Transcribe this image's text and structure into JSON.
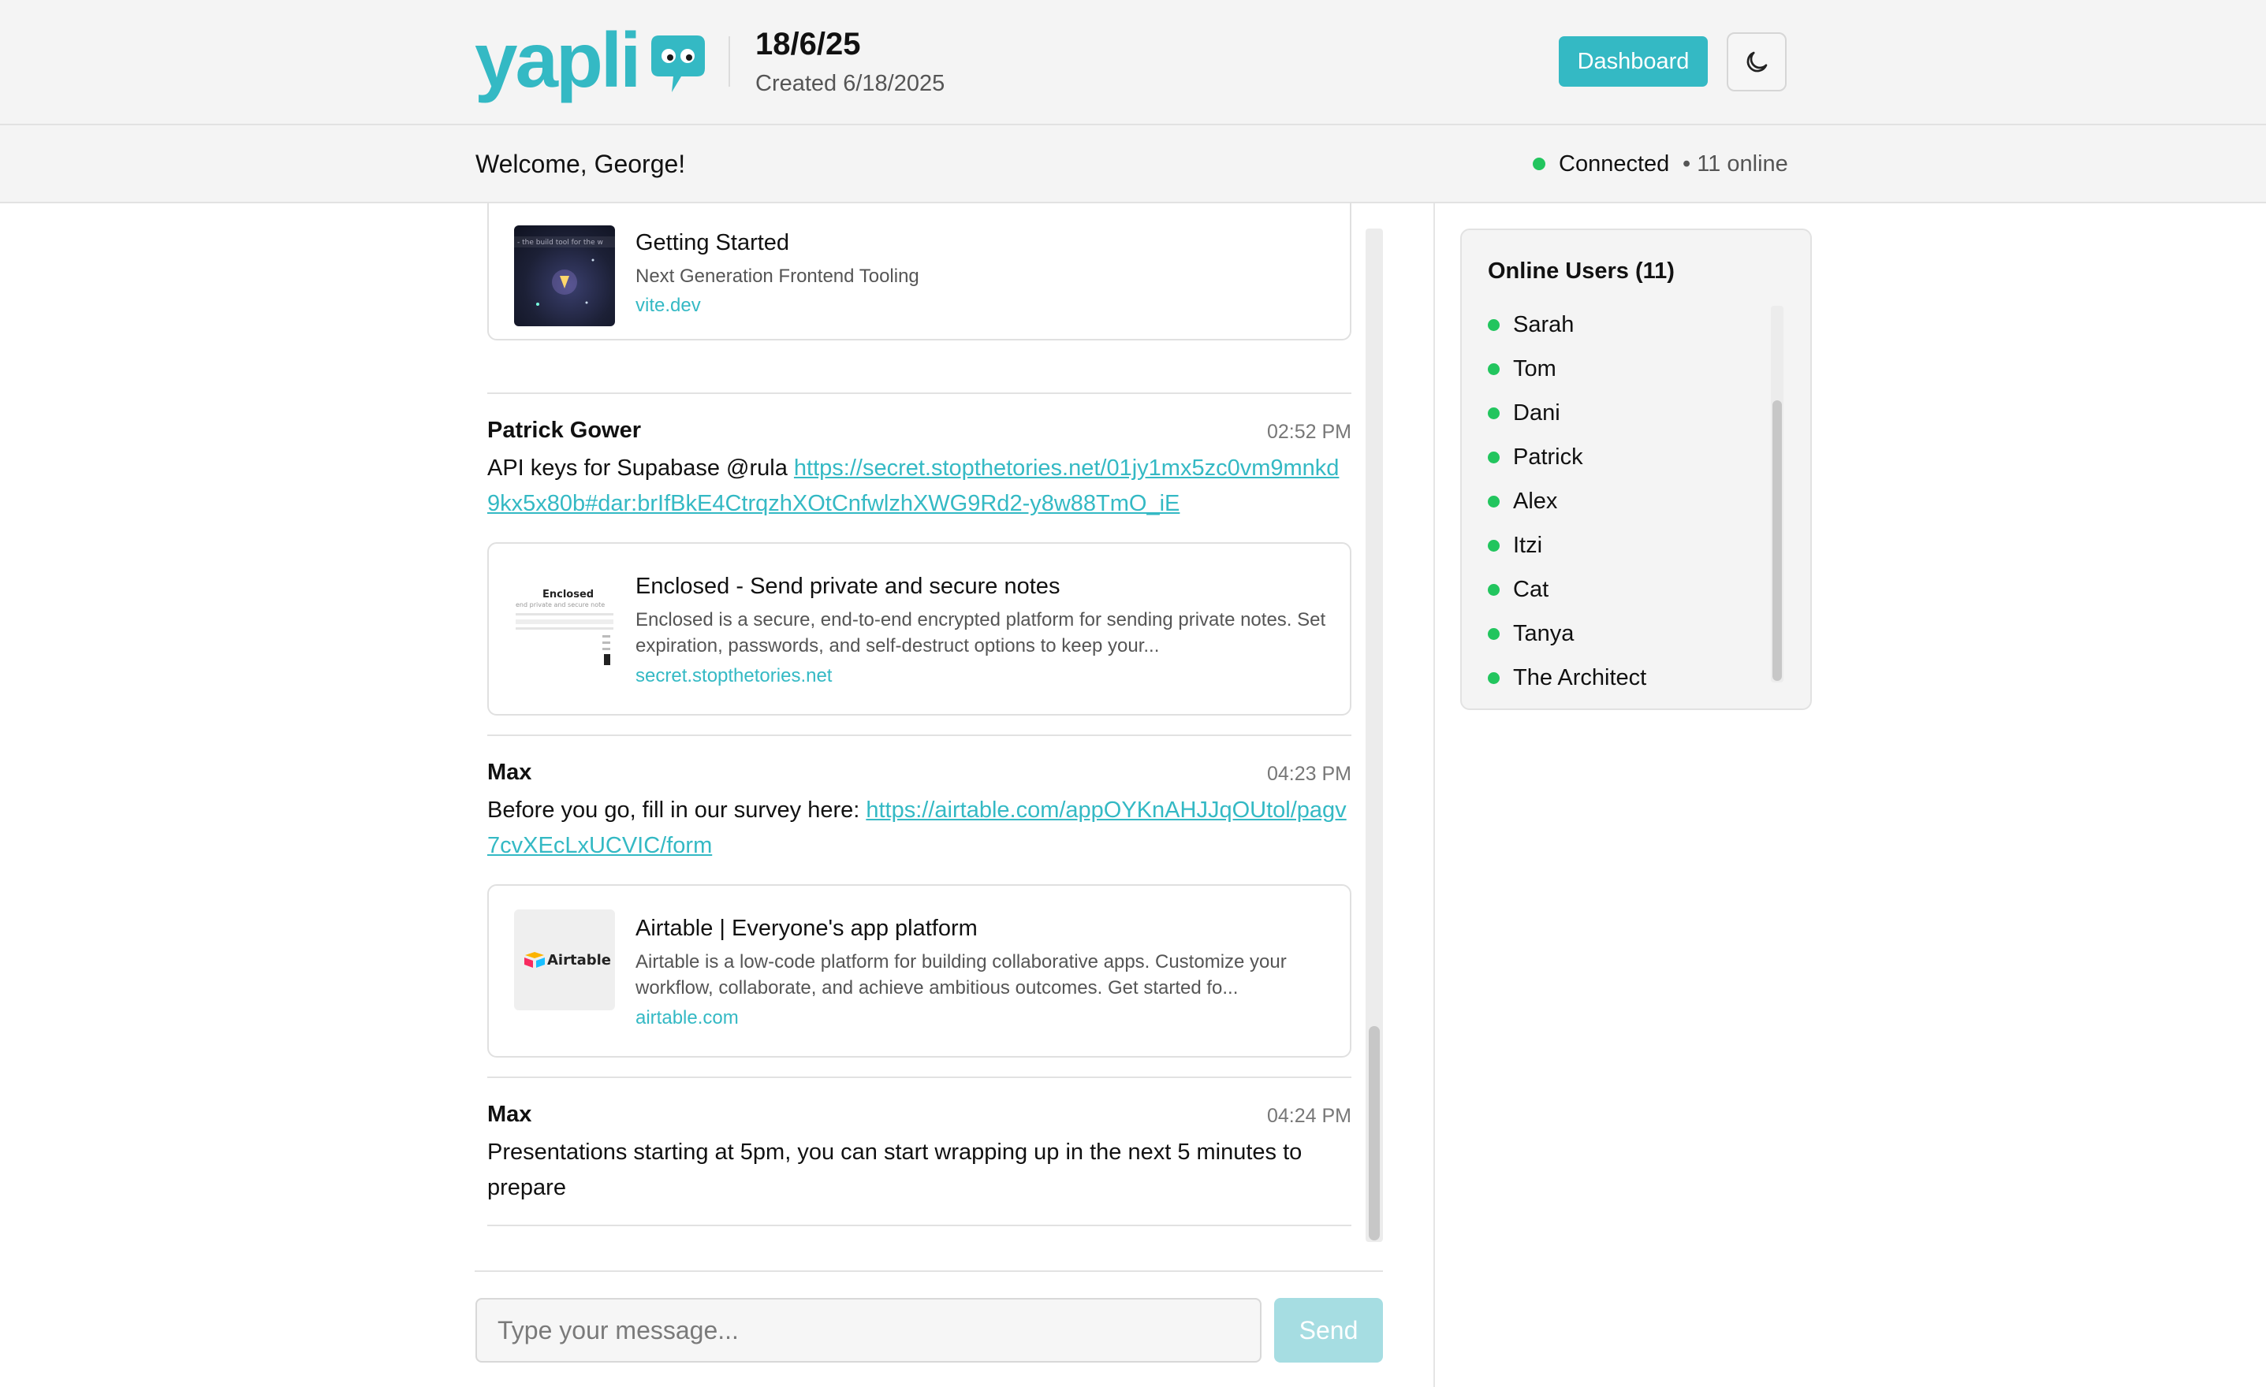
{
  "header": {
    "logo_text": "yapli",
    "room_title": "18/6/25",
    "room_created": "Created 6/18/2025",
    "dashboard_label": "Dashboard",
    "brand_color": "#34b9c4",
    "theme_icon": "moon-icon"
  },
  "subbar": {
    "welcome": "Welcome, George!",
    "status": "Connected",
    "online": "• 11 online",
    "status_color": "#22c55e"
  },
  "messages": [
    {
      "preview": {
        "title": "Getting Started",
        "description": "Next Generation Frontend Tooling",
        "domain": "vite.dev"
      }
    },
    {
      "author": "Patrick Gower",
      "time": "02:52 PM",
      "text": "API keys for Supabase @rula ",
      "link": "https://secret.stopthetories.net/01jy1mx5zc0vm9mnkd9kx5x80b#dar:brIfBkE4CtrqzhXOtCnfwlzhXWG9Rd2-y8w88TmO_iE",
      "preview": {
        "title": "Enclosed - Send private and secure notes",
        "description": "Enclosed is a secure, end-to-end encrypted platform for sending private notes. Set expiration, passwords, and self-destruct options to keep your...",
        "domain": "secret.stopthetories.net",
        "thumb_label": "Enclosed"
      }
    },
    {
      "author": "Max",
      "time": "04:23 PM",
      "text": "Before you go, fill in our survey here: ",
      "link": "https://airtable.com/appOYKnAHJJqOUtol/pagv7cvXEcLxUCVIC/form",
      "preview": {
        "title": "Airtable | Everyone's app platform",
        "description": "Airtable is a low-code platform for building collaborative apps. Customize your workflow, collaborate, and achieve ambitious outcomes. Get started fo...",
        "domain": "airtable.com",
        "thumb_label": "Airtable"
      }
    },
    {
      "author": "Max",
      "time": "04:24 PM",
      "text": "Presentations starting at 5pm, you can start wrapping up in the next 5 minutes to prepare"
    }
  ],
  "composer": {
    "placeholder": "Type your message...",
    "send_label": "Send"
  },
  "users_panel": {
    "title": "Online Users (11)",
    "users": [
      "Sarah",
      "Tom",
      "Dani",
      "Patrick",
      "Alex",
      "Itzi",
      "Cat",
      "Tanya",
      "The Architect"
    ]
  }
}
